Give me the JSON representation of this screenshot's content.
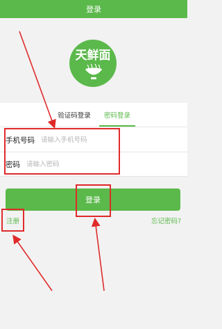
{
  "header": {
    "title": "登录"
  },
  "logo": {
    "text": "天鲜面"
  },
  "tabs": [
    {
      "label": "验证码登录",
      "active": false
    },
    {
      "label": "密码登录",
      "active": true
    }
  ],
  "form": {
    "phone": {
      "label": "手机号码",
      "placeholder": "请输入手机号码",
      "value": ""
    },
    "password": {
      "label": "密码",
      "placeholder": "请输入密码",
      "value": ""
    }
  },
  "actions": {
    "login_label": "登录",
    "register_label": "注册",
    "forgot_label": "忘记密码?"
  },
  "colors": {
    "brand": "#5bb94b",
    "annotation": "#e02a2a",
    "background": "#f2f2f2"
  }
}
